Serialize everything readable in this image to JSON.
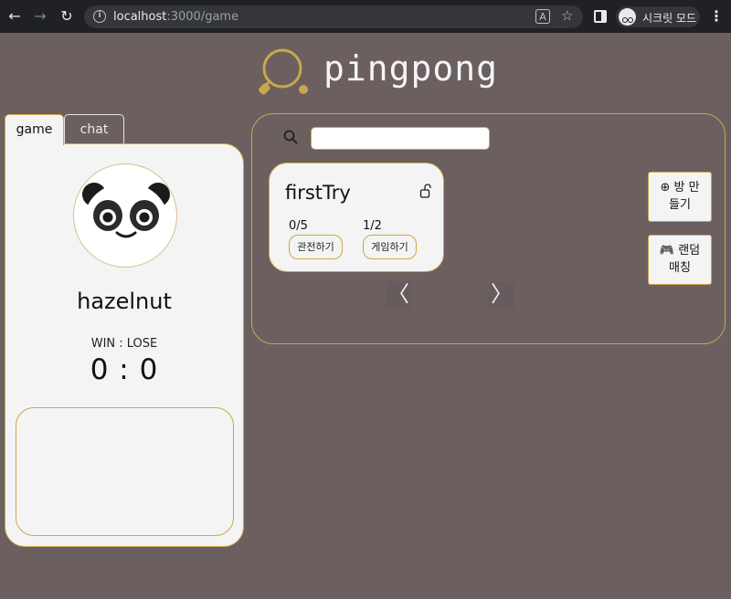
{
  "browser": {
    "back_icon": "←",
    "forward_icon": "→",
    "reload_icon": "↻",
    "url_host": "localhost",
    "url_path": ":3000/game",
    "incognito_label": "시크릿 모드",
    "menu_icon": "⋮"
  },
  "logo": {
    "text": "pingpong",
    "color": "#c9a84c"
  },
  "tabs": [
    {
      "label": "game"
    },
    {
      "label": "chat"
    }
  ],
  "profile": {
    "username": "hazelnut",
    "record_label": "WIN : LOSE",
    "score": "0 : 0"
  },
  "search": {
    "value": ""
  },
  "rooms": [
    {
      "title": "firstTry",
      "locked": false,
      "spectators": "0/5",
      "players": "1/2",
      "spectate_label": "관전하기",
      "join_label": "게임하기"
    }
  ],
  "pager": {
    "prev": "〈",
    "next": "〉"
  },
  "actions": {
    "create_room_icon": "⊕",
    "create_room_line1": "방 만",
    "create_room_line2": "들기",
    "random_match_icon": "🎮",
    "random_match_line1": "랜덤",
    "random_match_line2": "매칭"
  },
  "colors": {
    "background": "#6b5f60",
    "accent": "#c9a84c",
    "card": "#f4f4f4"
  }
}
